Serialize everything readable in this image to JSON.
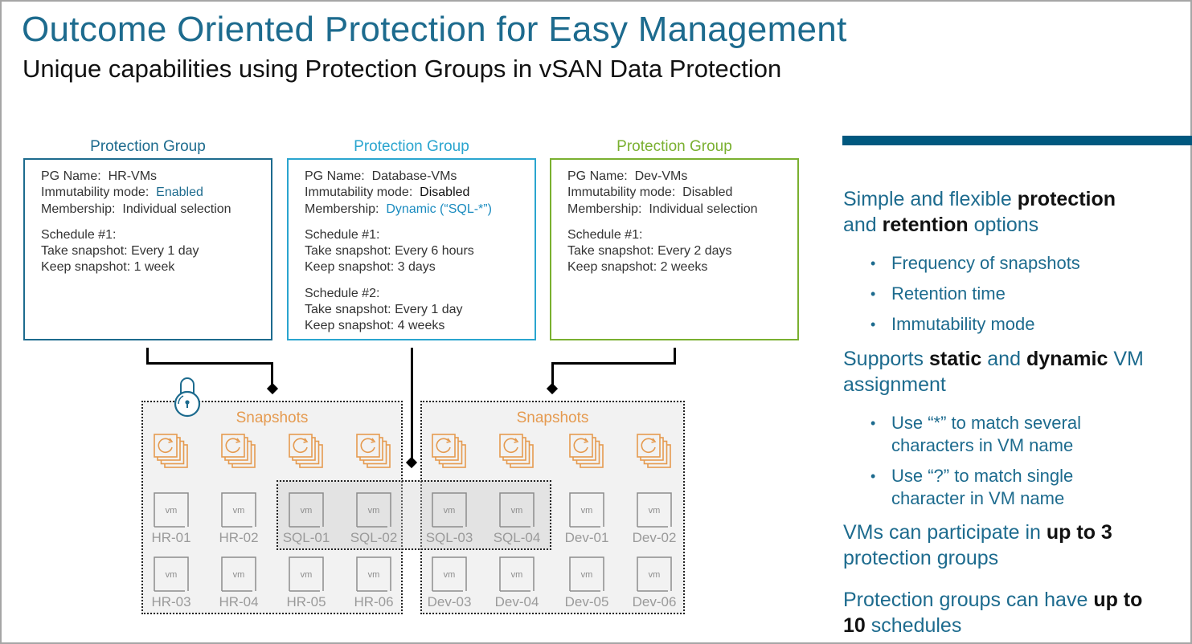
{
  "slide": {
    "title": "Outcome Oriented Protection for Easy Management",
    "subtitle": "Unique capabilities using Protection Groups in vSAN Data Protection"
  },
  "colors": {
    "title": "#1d6b8e",
    "pg1_border": "#1d6b8e",
    "pg2_border": "#2aa5cf",
    "pg3_border": "#7ab030",
    "snapshot": "#e59a4f",
    "accent_bar": "#00587f"
  },
  "protection_groups": [
    {
      "label": "Protection Group",
      "pg_name_label": "PG Name:",
      "pg_name": "HR-VMs",
      "immutability_label": "Immutability mode:",
      "immutability": "Enabled",
      "membership_label": "Membership:",
      "membership": "Individual selection",
      "schedules": [
        {
          "title": "Schedule #1:",
          "take": "Take snapshot: Every 1 day",
          "keep": "Keep snapshot:  1 week"
        }
      ]
    },
    {
      "label": "Protection Group",
      "pg_name_label": "PG Name:",
      "pg_name": "Database-VMs",
      "immutability_label": "Immutability mode:",
      "immutability": "Disabled",
      "membership_label": "Membership:",
      "membership": "Dynamic  (“SQL-*”)",
      "schedules": [
        {
          "title": "Schedule #1:",
          "take": "Take snapshot: Every 6 hours",
          "keep": "Keep snapshot:  3 days"
        },
        {
          "title": "Schedule #2:",
          "take": "Take snapshot: Every 1 day",
          "keep": "Keep snapshot:  4 weeks"
        }
      ]
    },
    {
      "label": "Protection Group",
      "pg_name_label": "PG Name:",
      "pg_name": "Dev-VMs",
      "immutability_label": "Immutability mode:",
      "immutability": "Disabled",
      "membership_label": "Membership:",
      "membership": "Individual selection",
      "schedules": [
        {
          "title": "Schedule #1:",
          "take": "Take snapshot: Every 2 days",
          "keep": "Keep snapshot:  2 weeks"
        }
      ]
    }
  ],
  "snapshot_areas": [
    {
      "title": "Snapshots",
      "icon": "snapshot-stack-icon",
      "locked": true
    },
    {
      "title": "Snapshots",
      "icon": "snapshot-stack-icon",
      "locked": false
    }
  ],
  "vm_icon_text": "vm",
  "vms": {
    "row1": [
      "HR-01",
      "HR-02",
      "SQL-01",
      "SQL-02",
      "SQL-03",
      "SQL-04",
      "Dev-01",
      "Dev-02"
    ],
    "row2": [
      "HR-03",
      "HR-04",
      "HR-05",
      "HR-06",
      "Dev-03",
      "Dev-04",
      "Dev-05",
      "Dev-06"
    ]
  },
  "right_panel": {
    "point1": {
      "pre": "Simple and flexible ",
      "b1": "protection",
      "mid": " and ",
      "b2": "retention",
      "post": " options"
    },
    "bullets1": [
      "Frequency of snapshots",
      "Retention time",
      "Immutability mode"
    ],
    "point2": {
      "pre": "Supports ",
      "b1": "static",
      "mid": " and ",
      "b2": "dynamic",
      "post": " VM assignment"
    },
    "bullets2": [
      "Use “*” to match several characters in VM name",
      "Use “?” to match single character in VM name"
    ],
    "point3": {
      "pre": "VMs can participate in ",
      "b1": "up to 3",
      "post": " protection groups"
    },
    "point4": {
      "pre": "Protection groups can have ",
      "b1": "up to 10",
      "post": " schedules"
    }
  }
}
